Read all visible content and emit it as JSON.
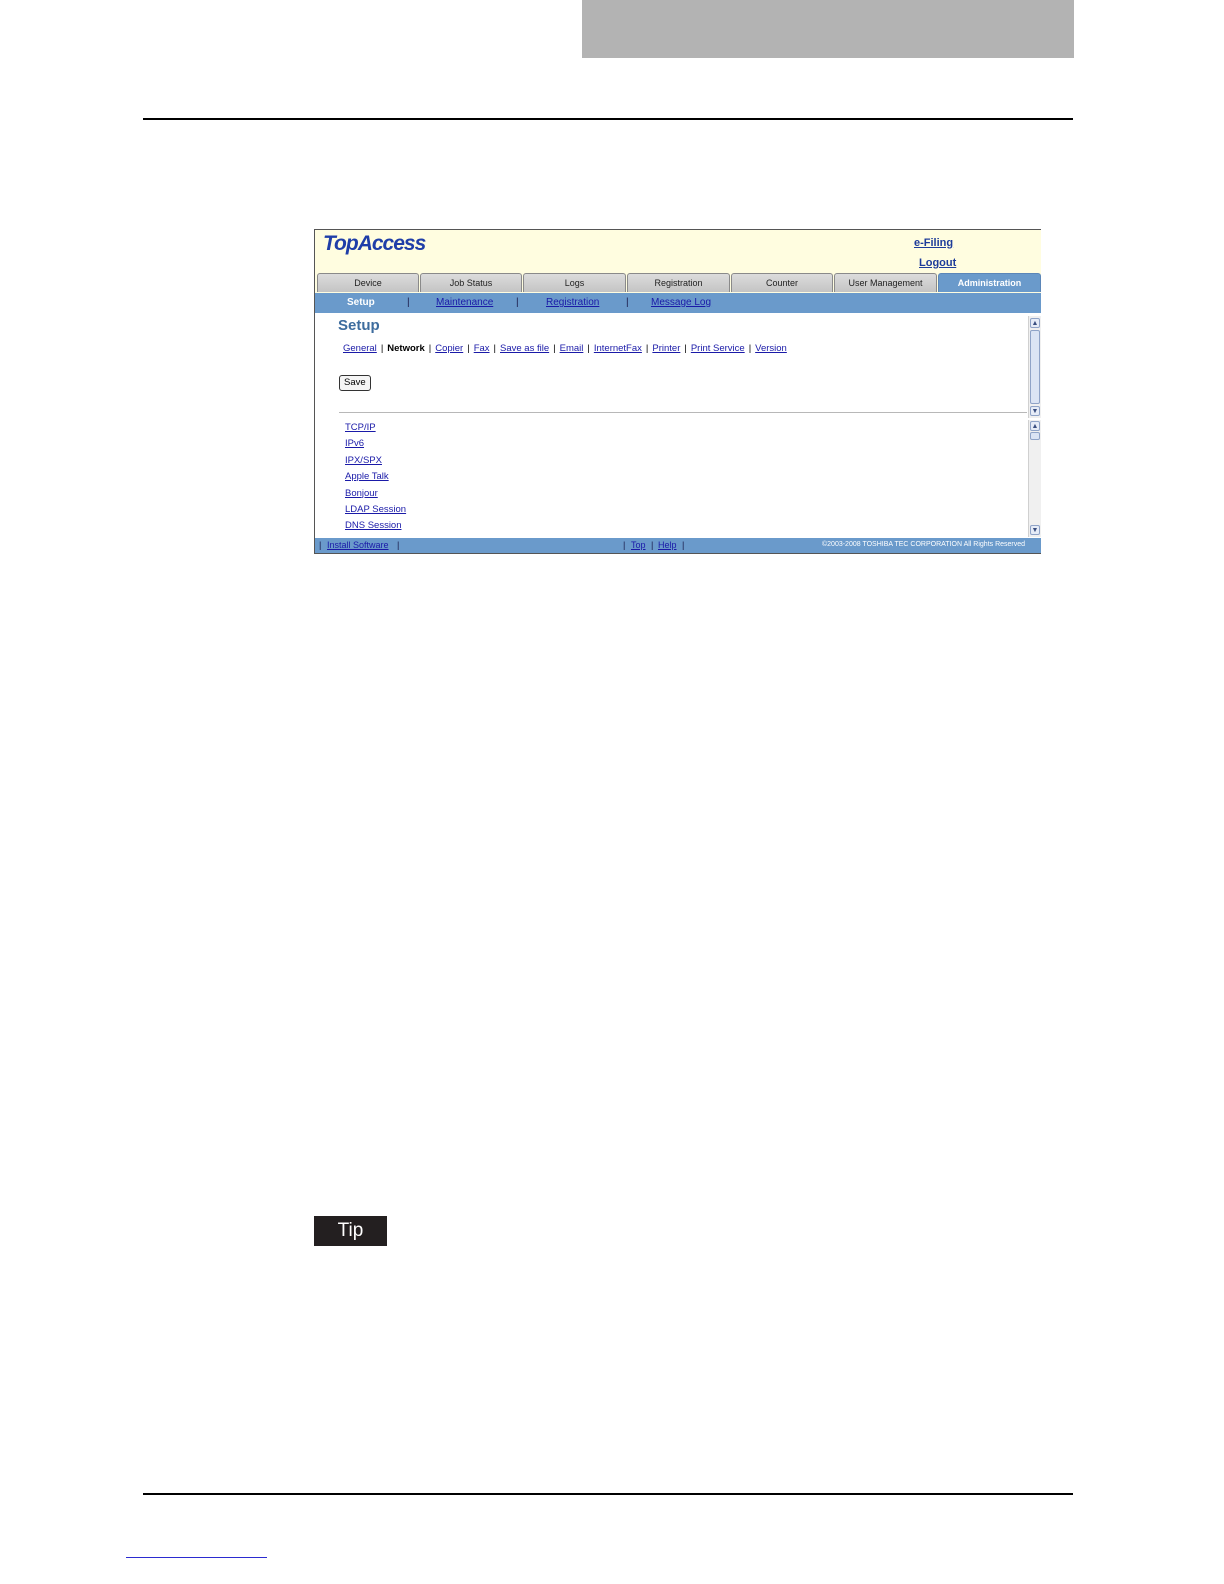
{
  "app": {
    "logo": "TopAccess",
    "header_links": {
      "efiling": "e-Filing",
      "logout": "Logout"
    }
  },
  "tabs": [
    "Device",
    "Job Status",
    "Logs",
    "Registration",
    "Counter",
    "User Management",
    "Administration"
  ],
  "active_tab": "Administration",
  "subnav": {
    "items": [
      "Setup",
      "Maintenance",
      "Registration",
      "Message Log"
    ],
    "separator": "|"
  },
  "content": {
    "title": "Setup",
    "setup_nav": [
      "General",
      "Network",
      "Copier",
      "Fax",
      "Save as file",
      "Email",
      "InternetFax",
      "Printer",
      "Print Service",
      "Version"
    ],
    "current_section": "Network",
    "save_label": "Save",
    "sections": [
      "TCP/IP",
      "IPv6",
      "IPX/SPX",
      "Apple Talk",
      "Bonjour",
      "LDAP Session",
      "DNS Session"
    ]
  },
  "footer": {
    "install_software": "Install Software",
    "top": "Top",
    "help": "Help",
    "separator": "|",
    "copyright": "©2003-2008 TOSHIBA TEC CORPORATION All Rights Reserved"
  },
  "tip_label": "Tip",
  "colors": {
    "accent": "#6a9acb",
    "header_bg": "#fffde0",
    "link": "#1a1aa8",
    "title": "#3d6c9e"
  }
}
